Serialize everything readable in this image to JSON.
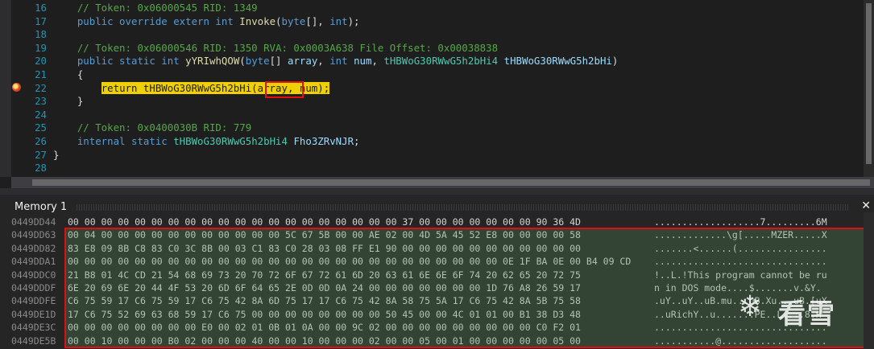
{
  "editor": {
    "lines": [
      {
        "n": "16",
        "html": "    <span class='cm'>// Token: 0x06000545 RID: 1349</span>"
      },
      {
        "n": "17",
        "html": "    <span class='kw'>public override extern int</span> <span class='fn'>Invoke</span><span class='pl'>(</span><span class='kw'>byte</span><span class='pl'>[], </span><span class='kw'>int</span><span class='pl'>);</span>"
      },
      {
        "n": "18",
        "html": ""
      },
      {
        "n": "19",
        "html": "    <span class='cm'>// Token: 0x06000546 RID: 1350 RVA: 0x0003A638 File Offset: 0x00038838</span>"
      },
      {
        "n": "20",
        "html": "    <span class='kw'>public static int</span> <span class='fn'>yYRIwhQOW</span><span class='pl'>(</span><span class='kw'>byte</span><span class='pl'>[] </span><span class='par'>array</span><span class='pl'>, </span><span class='kw'>int</span> <span class='par'>num</span><span class='pl'>, </span><span class='ty'>tHBWoG30RWwG5h2bHi4</span> <span class='par'>tHBWoG30RWwG5h2bHi</span><span class='pl'>)</span>"
      },
      {
        "n": "21",
        "html": "    <span class='pl'>{</span>"
      },
      {
        "n": "22",
        "html": "        <span class='hl'>return tHBWoG30RWwG5h2bHi(array, num);</span>"
      },
      {
        "n": "23",
        "html": "    <span class='pl'>}</span>"
      },
      {
        "n": "24",
        "html": ""
      },
      {
        "n": "25",
        "html": "    <span class='cm'>// Token: 0x0400030B RID: 779</span>"
      },
      {
        "n": "26",
        "html": "    <span class='kw'>internal static</span> <span class='ty'>tHBWoG30RWwG5h2bHi4</span> <span class='fd'>Fho3ZRvNJR</span><span class='pl'>;</span>"
      },
      {
        "n": "27",
        "html": "<span class='pl'>}</span>"
      },
      {
        "n": "28",
        "html": ""
      }
    ]
  },
  "memory": {
    "title": "Memory 1",
    "close_label": "✕",
    "rows": [
      {
        "addr": "0449DD44",
        "hex": "00 00 00 00 00 00 00 00 00 00 00 00 00 00 00 00 00 00 00 00 37 00 00 00 00 00 00 00 90 36 4D",
        "ascii": "...................7.........6M"
      },
      {
        "addr": "0449DD63",
        "hex": "00 04 00 00 00 00 00 00 00 00 00 00 00 5C 67 5B 00 00 AE 02 00 4D 5A 45 52 E8 00 00 00 00 58",
        "ascii": ".............\\g[.....MZER.....X"
      },
      {
        "addr": "0449DD82",
        "hex": "83 E8 09 8B C8 83 C0 3C 8B 00 03 C1 83 C0 28 03 08 FF E1 90 00 00 00 00 00 00 00 00 00 00 00",
        "ascii": ".......<......(................"
      },
      {
        "addr": "0449DDA1",
        "hex": "00 00 00 00 00 00 00 00 00 00 00 00 00 00 00 00 00 00 00 00 00 00 00 00 00 00 0E 1F BA 0E 00 B4 09 CD",
        "ascii": "..............................."
      },
      {
        "addr": "0449DDC0",
        "hex": "21 B8 01 4C CD 21 54 68 69 73 20 70 72 6F 67 72 61 6D 20 63 61 6E 6E 6F 74 20 62 65 20 72 75",
        "ascii": "!..L.!This program cannot be ru"
      },
      {
        "addr": "0449DDDF",
        "hex": "6E 20 69 6E 20 44 4F 53 20 6D 6F 64 65 2E 0D 0D 0A 24 00 00 00 00 00 00 00 1D 76 A8 26 59 17",
        "ascii": "n in DOS mode....$.......v.&Y."
      },
      {
        "addr": "0449DDFE",
        "hex": "C6 75 59 17 C6 75 59 17 C6 75 42 8A 6D 75 17 17 C6 75 42 8A 58 75 5A 17 C6 75 42 8A 5B 75 58",
        "ascii": ".uY..uY..uB.mu...uB.Xu...uB.[uX"
      },
      {
        "addr": "0449DE1D",
        "hex": "17 C6 75 52 69 63 68 59 17 C6 75 00 00 00 00 00 00 00 00 50 45 00 00 4C 01 01 00 B1 38 D3 48",
        "ascii": "..uRichY..u.......PE..L....8.H"
      },
      {
        "addr": "0449DE3C",
        "hex": "00 00 00 00 00 00 00 00 E0 00 02 01 0B 01 0A 00 00 9C 02 00 00 00 00 00 00 00 00 00 C0 F2 01",
        "ascii": "..............................."
      },
      {
        "addr": "0449DE5B",
        "hex": "00 00 10 00 00 00 B0 02 00 00 00 40 00 00 10 00 00 00 02 00 00 05 00 01 00 00 00 00 00 05 00",
        "ascii": "...........@..................."
      }
    ]
  },
  "watermark": {
    "icon": "❄",
    "text": "看雪"
  }
}
